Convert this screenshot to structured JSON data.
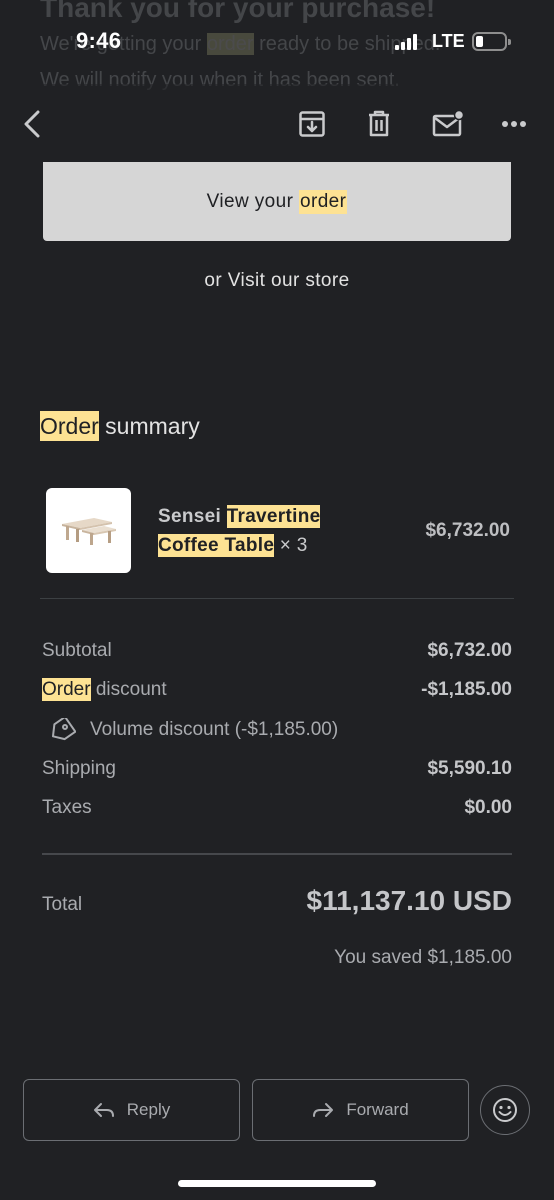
{
  "status_bar": {
    "time": "9:46",
    "network": "LTE",
    "battery_level": 0.25
  },
  "background_email": {
    "heading": "Thank you for your purchase!",
    "line1_prefix": "We're getting your ",
    "line1_highlight": "order",
    "line1_suffix": " ready to be shipped.",
    "line2": "We will notify you when it has been sent."
  },
  "toolbar": {
    "back_icon": "chevron-left-icon",
    "archive_icon": "archive-icon",
    "delete_icon": "trash-icon",
    "mark_unread_icon": "mail-unread-icon",
    "more_icon": "more-horizontal-icon"
  },
  "email": {
    "view_order_prefix": "View your ",
    "view_order_highlight": "order",
    "visit_store": "or Visit our store",
    "summary_title_highlight": "Order",
    "summary_title_rest": " summary",
    "product": {
      "name_prefix": "Sensei ",
      "name_highlight_1": "Travertine",
      "name_highlight_2": "Coffee Table",
      "quantity": " × 3",
      "price": "$6,732.00"
    },
    "subtotal_label": "Subtotal",
    "subtotal_value": "$6,732.00",
    "discount_label_highlight": "Order",
    "discount_label_rest": " discount",
    "discount_value": "-$1,185.00",
    "volume_discount": "Volume discount (-$1,185.00)",
    "shipping_label": "Shipping",
    "shipping_value": "$5,590.10",
    "taxes_label": "Taxes",
    "taxes_value": "$0.00",
    "total_label": "Total",
    "total_value": "$11,137.10 USD",
    "saved": "You saved $1,185.00"
  },
  "actions": {
    "reply_label": "Reply",
    "forward_label": "Forward",
    "emoji_icon": "emoji-smile-icon"
  },
  "colors": {
    "background": "#202124",
    "highlight": "#fde293",
    "button_bg": "#d6d6d6"
  }
}
